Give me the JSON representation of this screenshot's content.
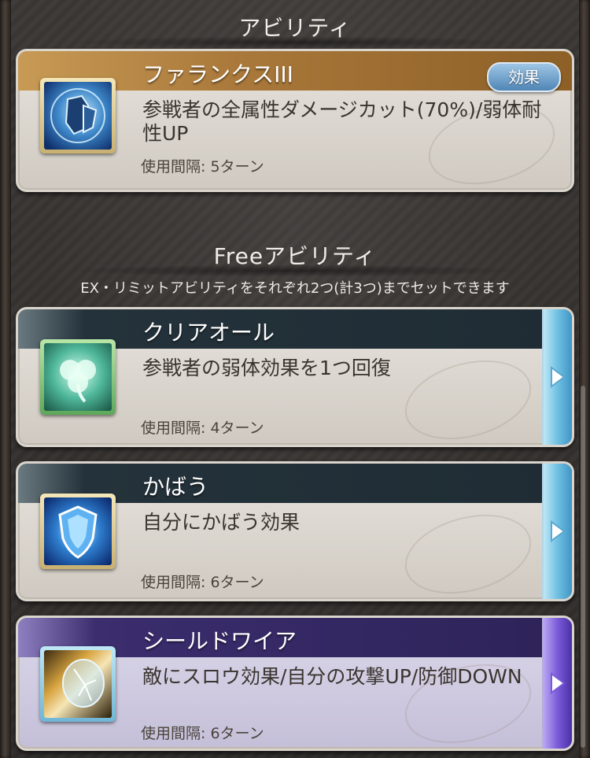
{
  "sections": {
    "ability_title": "アビリティ",
    "free_ability_title": "Freeアビリティ",
    "free_ability_note": "EX・リミットアビリティをそれぞれ2つ(計3つ)までセットできます"
  },
  "main_ability": {
    "name": "ファランクスIII",
    "description": "参戦者の全属性ダメージカット(70%)/弱体耐性UP",
    "interval": "使用間隔: 5ターン",
    "effect_button": "効果",
    "icon": "knight-shield-icon"
  },
  "free_abilities": [
    {
      "name": "クリアオール",
      "description": "参戦者の弱体効果を1つ回復",
      "interval": "使用間隔: 4ターン",
      "icon": "clover-icon"
    },
    {
      "name": "かばう",
      "description": "自分にかばう効果",
      "interval": "使用間隔: 6ターン",
      "icon": "shield-icon"
    },
    {
      "name": "シールドワイア",
      "description": "敵にスロウ効果/自分の攻撃UP/防御DOWN",
      "interval": "使用間隔: 6ターン",
      "icon": "shield-shatter-icon"
    }
  ],
  "colors": {
    "main_band": "#a9783a",
    "free_band_dark": "#24323b",
    "arrow_tab_blue": "#7cc6e6",
    "arrow_tab_purple": "#6b4fc2",
    "card_purple_bg": "#cbc6de"
  }
}
